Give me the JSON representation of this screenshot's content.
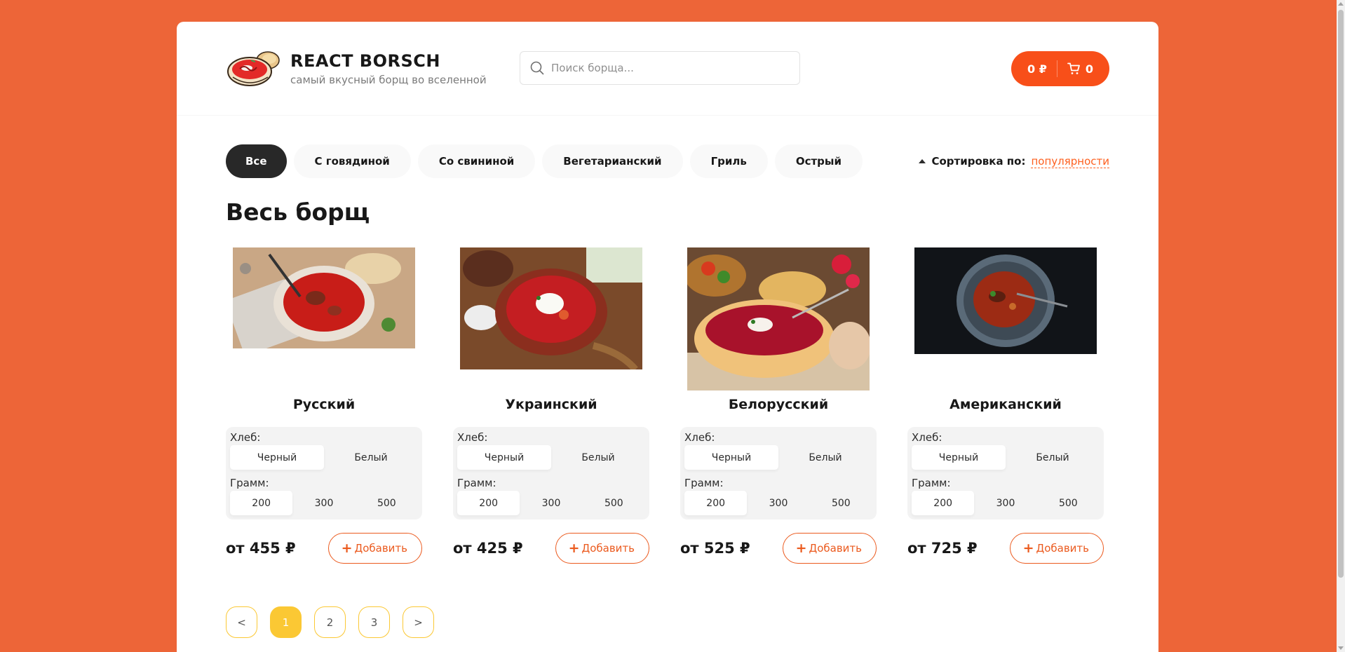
{
  "header": {
    "logo_title": "REACT BORSCH",
    "logo_subtitle": "самый вкусный борщ во вселенной",
    "search_placeholder": "Поиск борща...",
    "cart_price": "0 ₽",
    "cart_count": "0"
  },
  "categories": [
    "Все",
    "С говядиной",
    "Со свининой",
    "Вегетарианский",
    "Гриль",
    "Острый"
  ],
  "sort": {
    "label": "Сортировка по:",
    "value": "популярности"
  },
  "section_title": "Весь борщ",
  "options": {
    "bread_label": "Хлеб:",
    "bread_choices": [
      "Черный",
      "Белый"
    ],
    "gram_label": "Грамм:",
    "gram_choices": [
      "200",
      "300",
      "500"
    ]
  },
  "add_label": "Добавить",
  "products": [
    {
      "name": "Русский",
      "price": "от 455 ₽"
    },
    {
      "name": "Украинский",
      "price": "от 425 ₽"
    },
    {
      "name": "Белорусский",
      "price": "от 525 ₽"
    },
    {
      "name": "Американский",
      "price": "от 725 ₽"
    }
  ],
  "pagination": {
    "prev": "<",
    "pages": [
      "1",
      "2",
      "3"
    ],
    "next": ">"
  },
  "colors": {
    "background": "#ED6538",
    "accent": "#FE5F1E",
    "page_active": "#FBC834"
  }
}
